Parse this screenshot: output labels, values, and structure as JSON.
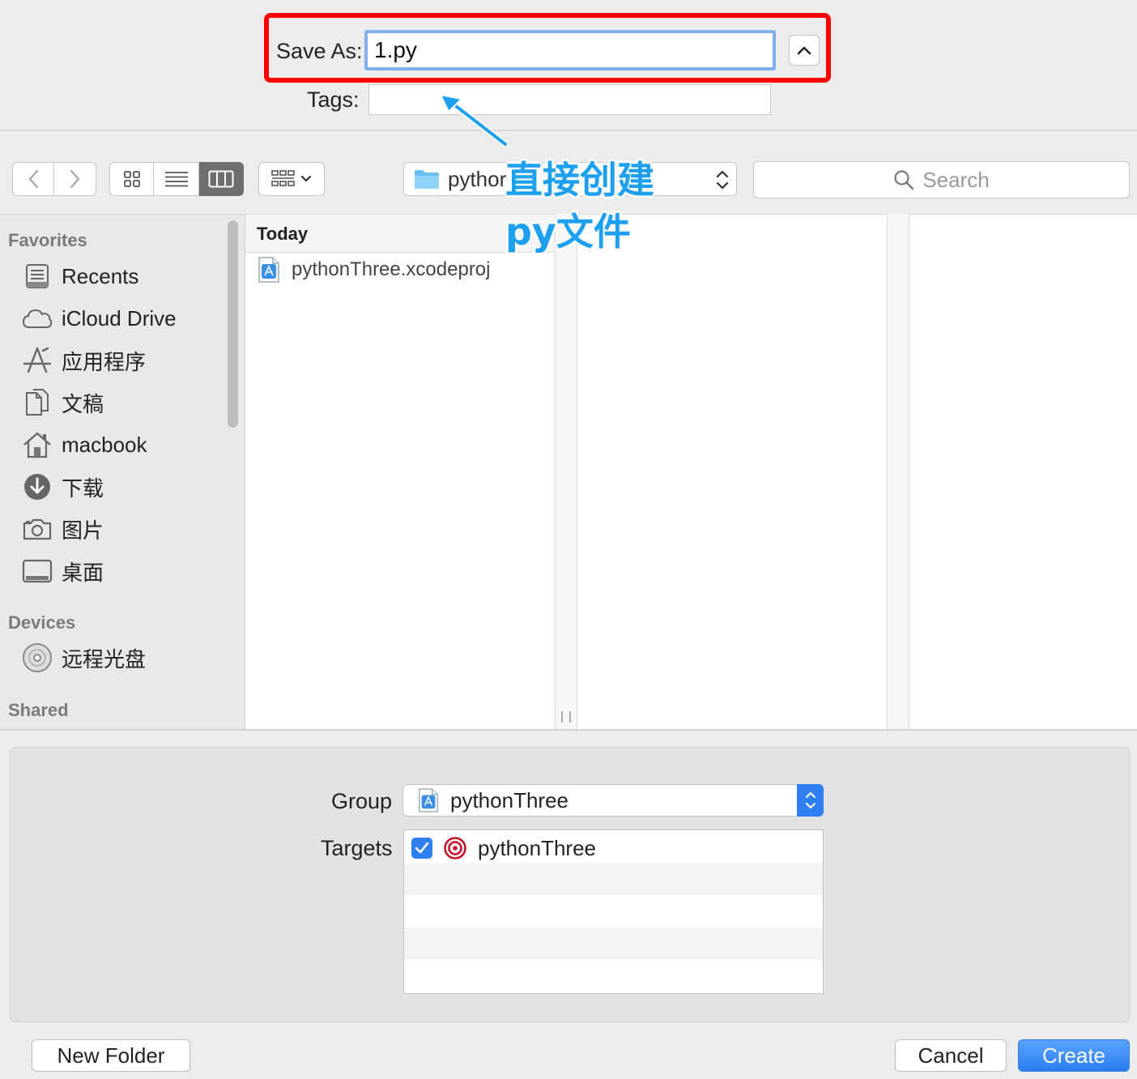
{
  "save_panel": {
    "save_as_label": "Save As:",
    "save_as_value": "1.py",
    "tags_label": "Tags:",
    "tags_value": ""
  },
  "toolbar": {
    "path_label": "pythor",
    "search_placeholder": "Search"
  },
  "sidebar": {
    "favorites_header": "Favorites",
    "favorites": [
      {
        "label": "Recents",
        "icon": "recents-icon"
      },
      {
        "label": "iCloud Drive",
        "icon": "cloud-icon"
      },
      {
        "label": "应用程序",
        "icon": "applications-icon"
      },
      {
        "label": "文稿",
        "icon": "documents-icon"
      },
      {
        "label": "macbook",
        "icon": "home-icon"
      },
      {
        "label": "下载",
        "icon": "downloads-icon"
      },
      {
        "label": "图片",
        "icon": "camera-icon"
      },
      {
        "label": "桌面",
        "icon": "desktop-icon"
      }
    ],
    "devices_header": "Devices",
    "devices": [
      {
        "label": "远程光盘",
        "icon": "disc-icon"
      }
    ],
    "shared_header": "Shared"
  },
  "browser": {
    "column1_header": "Today",
    "column1_items": [
      {
        "label": "pythonThree.xcodeproj",
        "icon": "xcodeproj-icon"
      }
    ]
  },
  "annotation": {
    "line1": "直接创建",
    "line2": "py文件",
    "color": "#1ea0f0"
  },
  "options": {
    "group_label": "Group",
    "group_value": "pythonThree",
    "targets_label": "Targets",
    "targets": [
      {
        "name": "pythonThree",
        "checked": true
      }
    ]
  },
  "buttons": {
    "new_folder": "New Folder",
    "cancel": "Cancel",
    "create": "Create"
  },
  "colors": {
    "accent": "#2f7ef2",
    "highlight_box": "#ff0000"
  }
}
